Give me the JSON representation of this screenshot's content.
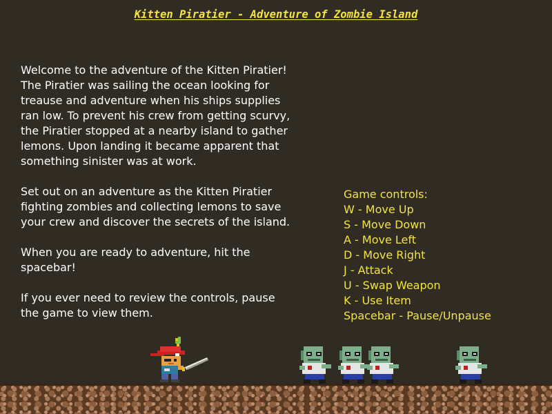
{
  "title": "Kitten Piratier - Adventure of Zombie Island",
  "intro": {
    "paragraphs": [
      "Welcome to the adventure of the Kitten Piratier!\nThe Piratier was sailing the ocean looking for\ntreause and adventure when his ships supplies\nran low. To prevent his crew from getting scurvy,\nthe Piratier stopped at a nearby island to gather\nlemons. Upon landing it became apparent that\nsomething sinister was at work.",
      "Set out on an adventure as the Kitten Piratier\nfighting zombies and collecting lemons to save\nyour crew and discover the secrets of the island.",
      "When you are ready to adventure, hit the\nspacebar!",
      "If you ever need to review the controls, pause\nthe game to view them."
    ]
  },
  "controls": {
    "header": "Game controls:",
    "items": [
      "W - Move Up",
      "S - Move Down",
      "A - Move Left",
      "D - Move Right",
      "J - Attack",
      "U - Swap Weapon",
      "K - Use Item",
      "Spacebar - Pause/Unpause"
    ]
  },
  "colors": {
    "background": "#302c24",
    "title": "#f2e33e",
    "controls_text": "#f2e33e",
    "intro_text": "#ffffff",
    "ground": "#5a3a22"
  },
  "sprites": {
    "player": "kitten-pirate-sprite",
    "enemies": [
      "zombie-sprite",
      "zombie-sprite",
      "zombie-sprite",
      "zombie-sprite"
    ]
  }
}
